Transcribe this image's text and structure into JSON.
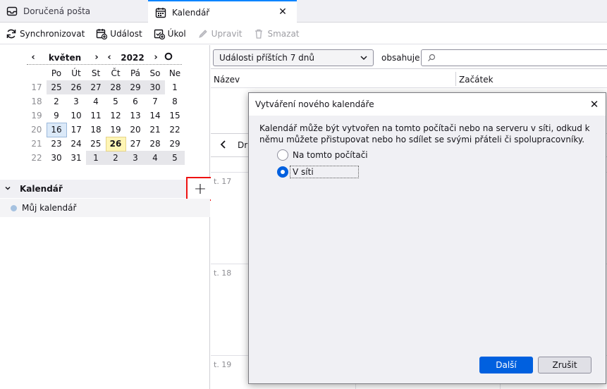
{
  "tabs": [
    {
      "label": "Doručená pošta",
      "icon": "inbox-icon",
      "active": false
    },
    {
      "label": "Kalendář",
      "icon": "calendar-icon",
      "active": true
    }
  ],
  "toolbar": {
    "sync": "Synchronizovat",
    "event": "Událost",
    "task": "Úkol",
    "edit": "Upravit",
    "delete": "Smazat"
  },
  "minical": {
    "month": "květen",
    "year": "2022",
    "weekdays": [
      "Po",
      "Út",
      "St",
      "Čt",
      "Pá",
      "So",
      "Ne"
    ],
    "weeks": [
      {
        "wk": "17",
        "days": [
          "25",
          "26",
          "27",
          "28",
          "29",
          "30",
          "1"
        ]
      },
      {
        "wk": "18",
        "days": [
          "2",
          "3",
          "4",
          "5",
          "6",
          "7",
          "8"
        ]
      },
      {
        "wk": "19",
        "days": [
          "9",
          "10",
          "11",
          "12",
          "13",
          "14",
          "15"
        ]
      },
      {
        "wk": "20",
        "days": [
          "16",
          "17",
          "18",
          "19",
          "20",
          "21",
          "22"
        ]
      },
      {
        "wk": "21",
        "days": [
          "23",
          "24",
          "25",
          "26",
          "27",
          "28",
          "29"
        ]
      },
      {
        "wk": "22",
        "days": [
          "30",
          "31",
          "1",
          "2",
          "3",
          "4",
          "5"
        ]
      }
    ],
    "selected": "16",
    "today": "26"
  },
  "calendars": {
    "section_title": "Kalendář",
    "add_label": "+",
    "items": [
      {
        "name": "Můj kalendář",
        "color": "#a6c2e0"
      }
    ]
  },
  "filter": {
    "selected": "Události příštích 7 dnů",
    "contains_label": "obsahuje",
    "search_value": ""
  },
  "list": {
    "col_name": "Název",
    "col_start": "Začátek"
  },
  "view": {
    "prev": "<",
    "partial_label": "Dr"
  },
  "days": [
    {
      "label": "t. 17"
    },
    {
      "label": "t. 18"
    },
    {
      "label": "t. 19"
    }
  ],
  "dialog": {
    "title": "Vytváření nového kalendáře",
    "close": "✕",
    "description": "Kalendář může být vytvořen na tomto počítači nebo na serveru v síti, odkud k němu můžete přistupovat nebo ho sdílet se svými přáteli či spolupracovníky.",
    "options": [
      {
        "label": "Na tomto počítači",
        "checked": false
      },
      {
        "label": "V síti",
        "checked": true
      }
    ],
    "next": "Další",
    "cancel": "Zrušit"
  }
}
